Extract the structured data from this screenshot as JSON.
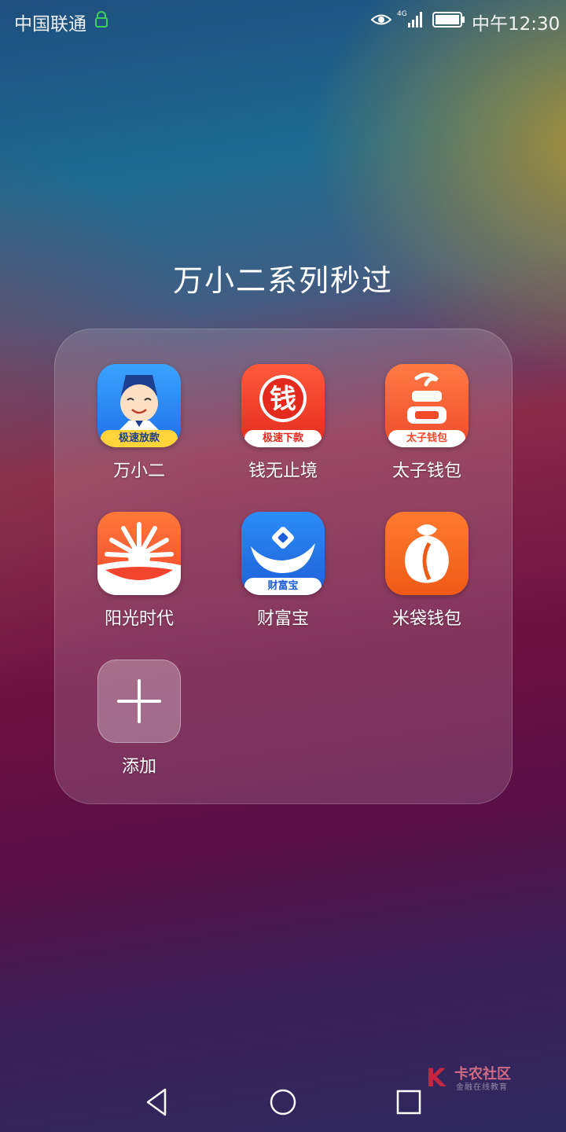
{
  "status": {
    "carrier": "中国联通",
    "network": "4G",
    "time": "中午12:30"
  },
  "folder": {
    "title": "万小二系列秒过",
    "apps": [
      {
        "label": "万小二",
        "icon": "wanxiaoer-app-icon",
        "ribbon": "极速放款"
      },
      {
        "label": "钱无止境",
        "icon": "qian-app-icon",
        "glyph": "钱",
        "ribbon": "极速下款"
      },
      {
        "label": "太子钱包",
        "icon": "taizi-wallet-app-icon",
        "ribbon": "太子钱包"
      },
      {
        "label": "阳光时代",
        "icon": "sunshine-app-icon"
      },
      {
        "label": "财富宝",
        "icon": "caifubao-app-icon",
        "ribbon": "财富宝"
      },
      {
        "label": "米袋钱包",
        "icon": "midai-wallet-app-icon"
      }
    ],
    "add_label": "添加"
  },
  "watermark": {
    "logo": "K",
    "title": "卡农社区",
    "subtitle": "金融在线教育"
  },
  "colors": {
    "accent_red": "#e32a1d",
    "accent_blue": "#1f6fe8",
    "accent_orange": "#f04b2a"
  }
}
